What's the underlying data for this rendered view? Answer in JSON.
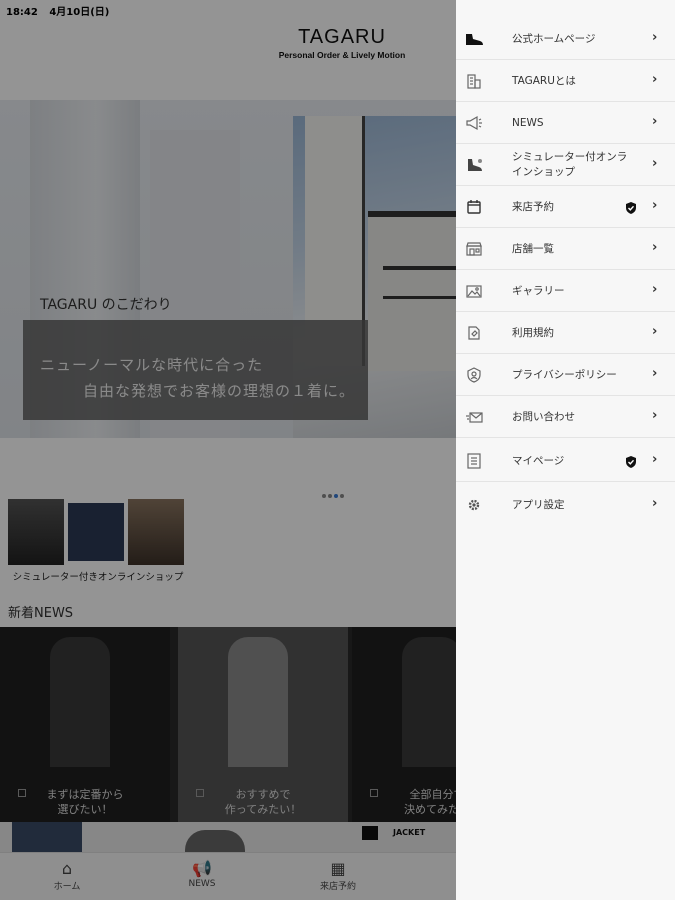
{
  "status_bar": {
    "time": "18:42",
    "date": "4月10日(日)"
  },
  "header": {
    "title": "TAGARU",
    "subtitle": "Personal Order & Lively Motion"
  },
  "hero": {
    "label": "TAGARU のこだわり",
    "line1": "ニューノーマルな時代に合った",
    "line2": "自由な発想でお客様の理想の１着に。"
  },
  "shop_banner": {
    "label": "シミュレーター付きオンラインショップ"
  },
  "news": {
    "heading": "新着NEWS",
    "cards": [
      {
        "line1": "まずは定番から",
        "line2": "選びたい！"
      },
      {
        "line1": "おすすめで",
        "line2": "作ってみたい！"
      },
      {
        "line1": "全部自分で",
        "line2": "決めてみたい"
      }
    ]
  },
  "promo": {
    "jacket": "JACKET"
  },
  "bottom_nav": {
    "items": [
      {
        "label": "ホーム",
        "icon": "home-icon"
      },
      {
        "label": "NEWS",
        "icon": "megaphone-icon"
      },
      {
        "label": "来店予約",
        "icon": "calendar-icon"
      }
    ]
  },
  "drawer": {
    "items": [
      {
        "label": "公式ホームページ",
        "icon": "shoe-icon",
        "locked": false
      },
      {
        "label": "TAGARUとは",
        "icon": "building-icon",
        "locked": false
      },
      {
        "label": "NEWS",
        "icon": "megaphone-icon",
        "locked": false
      },
      {
        "label": "シミュレーター付オンラインショップ",
        "icon": "shoe-icon",
        "locked": false
      },
      {
        "label": "来店予約",
        "icon": "calendar-icon",
        "locked": true
      },
      {
        "label": "店舗一覧",
        "icon": "store-icon",
        "locked": false
      },
      {
        "label": "ギャラリー",
        "icon": "image-icon",
        "locked": false
      },
      {
        "label": "利用規約",
        "icon": "document-icon",
        "locked": false
      },
      {
        "label": "プライバシーポリシー",
        "icon": "shield-icon",
        "locked": false
      },
      {
        "label": "お問い合わせ",
        "icon": "mail-icon",
        "locked": false
      },
      {
        "label": "マイページ",
        "icon": "list-icon",
        "locked": true
      },
      {
        "label": "アプリ設定",
        "icon": "gear-icon",
        "locked": false
      }
    ]
  }
}
